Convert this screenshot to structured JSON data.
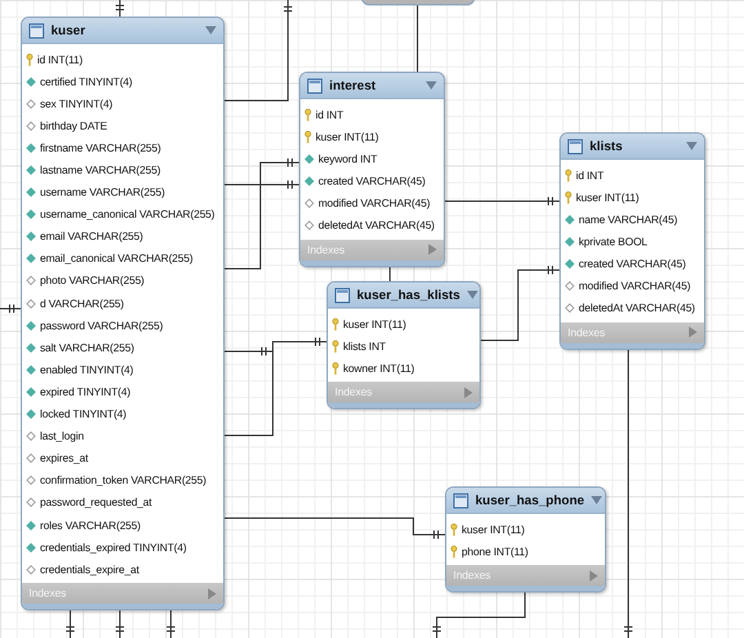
{
  "tables": [
    {
      "name": "kuser",
      "footer": "Indexes",
      "columns": [
        {
          "text": "id INT(11)",
          "kind": "key"
        },
        {
          "text": "certified TINYINT(4)",
          "kind": "required"
        },
        {
          "text": "sex TINYINT(4)",
          "kind": "nullable"
        },
        {
          "text": "birthday DATE",
          "kind": "nullable"
        },
        {
          "text": "firstname VARCHAR(255)",
          "kind": "required"
        },
        {
          "text": "lastname VARCHAR(255)",
          "kind": "required"
        },
        {
          "text": "username VARCHAR(255)",
          "kind": "required"
        },
        {
          "text": "username_canonical VARCHAR(255)",
          "kind": "required"
        },
        {
          "text": "email VARCHAR(255)",
          "kind": "required"
        },
        {
          "text": "email_canonical VARCHAR(255)",
          "kind": "required"
        },
        {
          "text": "photo VARCHAR(255)",
          "kind": "nullable"
        },
        {
          "text": "d VARCHAR(255)",
          "kind": "nullable"
        },
        {
          "text": "password VARCHAR(255)",
          "kind": "required"
        },
        {
          "text": "salt VARCHAR(255)",
          "kind": "required"
        },
        {
          "text": "enabled TINYINT(4)",
          "kind": "required"
        },
        {
          "text": "expired TINYINT(4)",
          "kind": "required"
        },
        {
          "text": "locked TINYINT(4)",
          "kind": "required"
        },
        {
          "text": "last_login",
          "kind": "nullable"
        },
        {
          "text": "expires_at",
          "kind": "nullable"
        },
        {
          "text": "confirmation_token VARCHAR(255)",
          "kind": "nullable"
        },
        {
          "text": "password_requested_at",
          "kind": "nullable"
        },
        {
          "text": "roles VARCHAR(255)",
          "kind": "required"
        },
        {
          "text": "credentials_expired TINYINT(4)",
          "kind": "required"
        },
        {
          "text": "credentials_expire_at",
          "kind": "nullable"
        }
      ]
    },
    {
      "name": "interest",
      "footer": "Indexes",
      "columns": [
        {
          "text": "id INT",
          "kind": "key"
        },
        {
          "text": "kuser INT(11)",
          "kind": "key"
        },
        {
          "text": "keyword INT",
          "kind": "required"
        },
        {
          "text": "created VARCHAR(45)",
          "kind": "required"
        },
        {
          "text": "modified VARCHAR(45)",
          "kind": "nullable"
        },
        {
          "text": "deletedAt VARCHAR(45)",
          "kind": "nullable"
        }
      ]
    },
    {
      "name": "kuser_has_klists",
      "footer": "Indexes",
      "columns": [
        {
          "text": "kuser INT(11)",
          "kind": "key"
        },
        {
          "text": "klists INT",
          "kind": "key"
        },
        {
          "text": "kowner INT(11)",
          "kind": "key"
        }
      ]
    },
    {
      "name": "klists",
      "footer": "Indexes",
      "columns": [
        {
          "text": "id INT",
          "kind": "key"
        },
        {
          "text": "kuser INT(11)",
          "kind": "key"
        },
        {
          "text": "name VARCHAR(45)",
          "kind": "required"
        },
        {
          "text": "kprivate BOOL",
          "kind": "required"
        },
        {
          "text": "created VARCHAR(45)",
          "kind": "required"
        },
        {
          "text": "modified VARCHAR(45)",
          "kind": "nullable"
        },
        {
          "text": "deletedAt VARCHAR(45)",
          "kind": "nullable"
        }
      ]
    },
    {
      "name": "kuser_has_phone",
      "footer": "Indexes",
      "columns": [
        {
          "text": "kuser INT(11)",
          "kind": "key"
        },
        {
          "text": "phone INT(11)",
          "kind": "key"
        }
      ]
    }
  ]
}
